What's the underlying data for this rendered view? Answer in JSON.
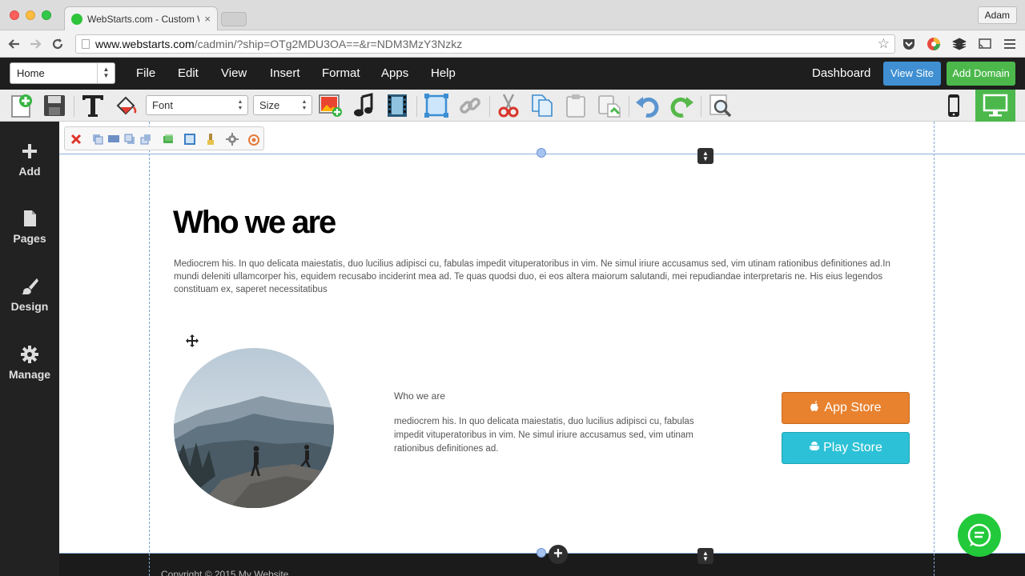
{
  "browser": {
    "tab_title": "WebStarts.com - Custom W",
    "tab_close": "×",
    "profile_name": "Adam",
    "url_host": "www.webstarts.com",
    "url_path": "/cadmin/?ship=OTg2MDU3OA==&r=NDM3MzY3Nzkz"
  },
  "menubar": {
    "page_select": "Home",
    "items": [
      "File",
      "Edit",
      "View",
      "Insert",
      "Format",
      "Apps",
      "Help"
    ],
    "dashboard": "Dashboard",
    "view_site": "View Site",
    "add_domain": "Add Domain"
  },
  "toolbar": {
    "font_select": "Font",
    "size_select": "Size"
  },
  "sidebar": {
    "items": [
      "Add",
      "Pages",
      "Design",
      "Manage"
    ]
  },
  "content": {
    "headline": "Who we are",
    "intro": "Mediocrem his. In quo delicata maiestatis, duo lucilius adipisci cu, fabulas impedit vituperatoribus in vim. Ne simul iriure accusamus sed, vim utinam rationibus definitiones ad.In mundi deleniti ullamcorper his, equidem recusabo inciderint mea ad. Te quas quodsi duo, ei eos altera maiorum salutandi, mei repudiandae interpretaris ne. His eius legendos constituam ex, saperet necessitatibus",
    "sub_heading": "Who we are",
    "sub_text": "mediocrem his. In quo delicata maiestatis, duo lucilius adipisci cu, fabulas impedit vituperatoribus in vim. Ne simul iriure accusamus sed, vim utinam rationibus definitiones ad.",
    "app_store_label": "App Store",
    "play_store_label": "Play Store",
    "copyright": "Copyright © 2015 My Website"
  },
  "colors": {
    "menubar_bg": "#1e1e1e",
    "view_site_btn": "#3f8fd2",
    "add_domain_btn": "#4cb84c",
    "app_store_btn": "#e8822f",
    "play_store_btn": "#2cc1d6",
    "chat_btn": "#22c93a"
  }
}
